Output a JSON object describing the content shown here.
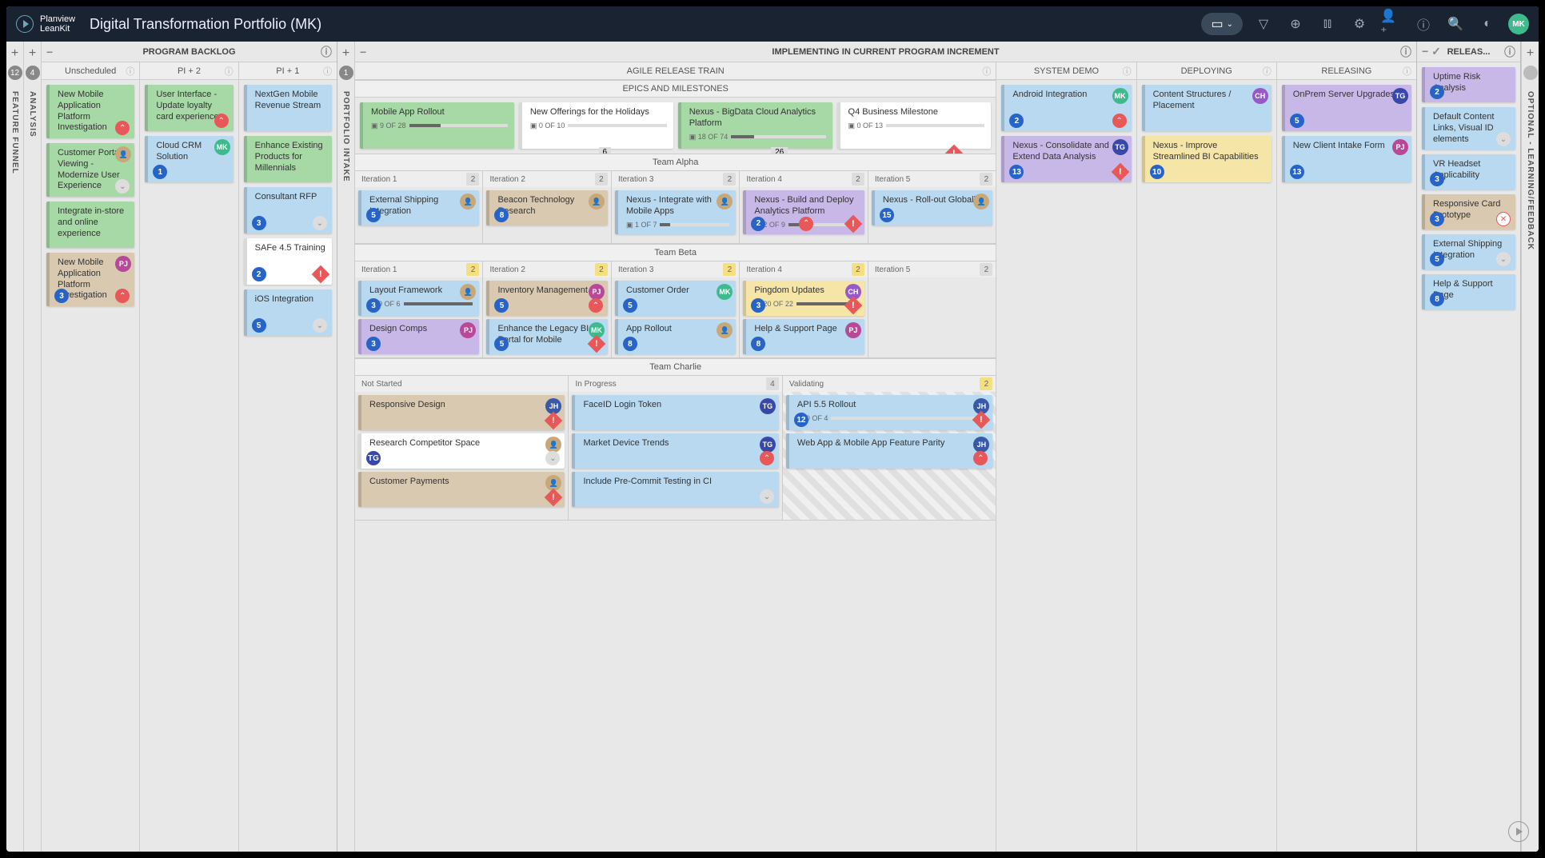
{
  "brand": {
    "name": "Planview",
    "product": "LeanKit"
  },
  "board_title": "Digital Transformation Portfolio (MK)",
  "user_avatar": "MK",
  "toolbar_icons": [
    "board-view-icon",
    "filter-icon",
    "zoom-icon",
    "analytics-icon",
    "settings-icon",
    "add-user-icon",
    "info-icon",
    "search-icon",
    "notifications-icon"
  ],
  "rails": {
    "left1": {
      "count": "12",
      "label": "FEATURE FUNNEL"
    },
    "left2": {
      "count": "4",
      "label": "ANALYSIS"
    },
    "mid": {
      "count": "1",
      "label": "PORTFOLIO INTAKE"
    },
    "right": {
      "count": "",
      "label": "OPTIONAL - LEARNING/FEEDBACK"
    }
  },
  "lanes": {
    "backlog": {
      "title": "PROGRAM BACKLOG",
      "sublanes": [
        {
          "title": "Unscheduled",
          "cards": [
            {
              "c": "green",
              "t": "New Mobile Application Platform Investigation",
              "bot_chev": "red"
            },
            {
              "c": "green",
              "t": "Customer Portal Viewing -Modernize User Experience",
              "av": "photo",
              "bot_chev": "grey"
            },
            {
              "c": "green",
              "t": "Integrate in-store and online experience"
            },
            {
              "c": "tan",
              "t": "New Mobile Application Platform Investigation",
              "av": "PJ",
              "badge": "3",
              "bot_chev": "red"
            }
          ]
        },
        {
          "title": "PI + 2",
          "cards": [
            {
              "c": "green",
              "t": "User Interface - Update loyalty card experience",
              "bot_chev": "red"
            },
            {
              "c": "blue",
              "t": "Cloud CRM Solution",
              "av": "MK",
              "badge": "1"
            }
          ]
        },
        {
          "title": "PI + 1",
          "cards": [
            {
              "c": "blue",
              "t": "NextGen Mobile Revenue Stream"
            },
            {
              "c": "green",
              "t": "Enhance Existing Products for Millennials"
            },
            {
              "c": "blue",
              "t": "Consultant RFP",
              "badge": "3",
              "bot_chev": "grey"
            },
            {
              "c": "white",
              "t": "SAFe 4.5 Training",
              "badge": "2",
              "alert": true
            },
            {
              "c": "blue",
              "t": "iOS Integration",
              "badge": "5",
              "bot_chev": "grey"
            }
          ]
        }
      ]
    },
    "implementing": {
      "title": "IMPLEMENTING IN CURRENT PROGRAM INCREMENT",
      "art": {
        "title": "AGILE RELEASE TRAIN",
        "epics": {
          "title": "EPICS AND MILESTONES",
          "cards": [
            {
              "c": "green",
              "t": "Mobile App Rollout",
              "prog": {
                "done": 9,
                "of": 28
              }
            },
            {
              "c": "white",
              "t": "New Offerings for the Holidays",
              "prog": {
                "done": 0,
                "of": 10
              }
            },
            {
              "c": "green",
              "t": "Nexus - BigData Cloud Analytics Platform",
              "prog": {
                "done": 18,
                "of": 74
              }
            },
            {
              "c": "white",
              "t": "Q4 Business Milestone",
              "prog": {
                "done": 0,
                "of": 13
              }
            }
          ],
          "markers": [
            "6",
            "26"
          ]
        },
        "teams": [
          {
            "name": "Team Alpha",
            "iterations": [
              {
                "name": "Iteration 1",
                "wip": "2",
                "cards": [
                  {
                    "c": "blue",
                    "t": "External Shipping Integration",
                    "badge": "5",
                    "av": "photo"
                  }
                ]
              },
              {
                "name": "Iteration 2",
                "wip": "2",
                "cards": [
                  {
                    "c": "tan",
                    "t": "Beacon Technology Research",
                    "badge": "8",
                    "av": "photo"
                  }
                ]
              },
              {
                "name": "Iteration 3",
                "wip": "2",
                "cards": [
                  {
                    "c": "blue",
                    "t": "Nexus - Integrate with Mobile Apps",
                    "prog": {
                      "done": 1,
                      "of": 7
                    },
                    "av": "photo"
                  }
                ]
              },
              {
                "name": "Iteration 4",
                "wip": "2",
                "cards": [
                  {
                    "c": "purple",
                    "t": "Nexus - Build and Deploy Analytics Platform",
                    "prog": {
                      "done": 2,
                      "of": 9
                    },
                    "badge": "2",
                    "alert": true,
                    "bot_chev": "red"
                  }
                ]
              },
              {
                "name": "Iteration 5",
                "wip": "2",
                "cards": [
                  {
                    "c": "blue",
                    "t": "Nexus - Roll-out Globally",
                    "badge": "15",
                    "av": "photo"
                  }
                ]
              }
            ]
          },
          {
            "name": "Team Beta",
            "iterations": [
              {
                "name": "Iteration 1",
                "wip": "2",
                "wipy": true,
                "cards": [
                  {
                    "c": "blue",
                    "t": "Layout Framework",
                    "prog": {
                      "done": 9,
                      "of": 6
                    },
                    "badge": "3",
                    "av": "photo"
                  },
                  {
                    "c": "purple",
                    "t": "Design Comps",
                    "badge": "3",
                    "av": "PJ"
                  }
                ]
              },
              {
                "name": "Iteration 2",
                "wip": "2",
                "wipy": true,
                "cards": [
                  {
                    "c": "tan",
                    "t": "Inventory Management",
                    "badge": "5",
                    "av": "PJ",
                    "bot_chev": "red"
                  },
                  {
                    "c": "blue",
                    "t": "Enhance the Legacy BI Portal for Mobile",
                    "badge": "5",
                    "av": "MK",
                    "alert": true
                  }
                ]
              },
              {
                "name": "Iteration 3",
                "wip": "2",
                "wipy": true,
                "cards": [
                  {
                    "c": "blue",
                    "t": "Customer Order",
                    "badge": "5",
                    "av": "MK"
                  },
                  {
                    "c": "blue",
                    "t": "App Rollout",
                    "badge": "8",
                    "av": "photo"
                  }
                ]
              },
              {
                "name": "Iteration 4",
                "wip": "2",
                "wipy": true,
                "cards": [
                  {
                    "c": "yellow",
                    "t": "Pingdom Updates",
                    "prog": {
                      "done": 20,
                      "of": 22
                    },
                    "badge": "3",
                    "av": "CH",
                    "alert": true
                  },
                  {
                    "c": "blue",
                    "t": "Help & Support Page",
                    "badge": "8",
                    "av": "PJ"
                  }
                ]
              },
              {
                "name": "Iteration 5",
                "wip": "2",
                "cards": []
              }
            ]
          },
          {
            "name": "Team Charlie",
            "sublanes": [
              {
                "name": "Not Started",
                "cards": [
                  {
                    "c": "tan",
                    "t": "Responsive Design",
                    "av": "JH",
                    "alert": true
                  },
                  {
                    "c": "white",
                    "t": "Research Competitor Space",
                    "av": "photo",
                    "badge_tg": "TG",
                    "bot_chev": "grey"
                  },
                  {
                    "c": "tan",
                    "t": "Customer Payments",
                    "av": "photo",
                    "alert": true
                  }
                ]
              },
              {
                "name": "In Progress",
                "wip": "4",
                "cards": [
                  {
                    "c": "blue",
                    "t": "FaceID Login Token",
                    "av": "TG"
                  },
                  {
                    "c": "blue",
                    "t": "Market Device Trends",
                    "av": "TG",
                    "bot_chev": "red"
                  },
                  {
                    "c": "blue",
                    "t": "Include Pre-Commit Testing in CI",
                    "bot_chev": "grey"
                  }
                ]
              },
              {
                "name": "Validating",
                "wip": "2",
                "wipy": true,
                "cards": [
                  {
                    "c": "blue",
                    "t": "API 5.5 Rollout",
                    "prog": {
                      "done": 0,
                      "of": 4
                    },
                    "badge": "12",
                    "av": "JH",
                    "alert": true
                  },
                  {
                    "c": "blue",
                    "t": "Web App & Mobile App Feature Parity",
                    "av": "JH",
                    "bot_chev": "red"
                  }
                ]
              }
            ]
          }
        ]
      },
      "right_lanes": [
        {
          "title": "SYSTEM DEMO",
          "cards": [
            {
              "c": "blue",
              "t": "Android Integration",
              "av": "MK",
              "badge": "2",
              "bot_chev": "red"
            },
            {
              "c": "purple",
              "t": "Nexus - Consolidate and Extend Data Analysis",
              "av": "TG",
              "badge": "13",
              "alert": true
            }
          ]
        },
        {
          "title": "DEPLOYING",
          "cards": [
            {
              "c": "blue",
              "t": "Content Structures / Placement",
              "av": "CH"
            },
            {
              "c": "yellow",
              "t": "Nexus - Improve Streamlined BI Capabilities",
              "badge": "10"
            }
          ]
        },
        {
          "title": "RELEASING",
          "cards": [
            {
              "c": "purple",
              "t": "OnPrem Server Upgrades",
              "av": "TG",
              "badge": "5"
            },
            {
              "c": "blue",
              "t": "New Client Intake Form",
              "av": "PJ",
              "badge": "13"
            }
          ]
        }
      ]
    },
    "released": {
      "title": "RELEAS...",
      "cards": [
        {
          "c": "purple",
          "t": "Uptime Risk Analysis",
          "badge": "2"
        },
        {
          "c": "blue",
          "t": "Default Content Links, Visual ID elements",
          "bot_chev": "grey"
        },
        {
          "c": "blue",
          "t": "VR Headset Applicability",
          "badge": "3"
        },
        {
          "c": "tan",
          "t": "Responsive Card Prototype",
          "badge": "3",
          "close": true
        },
        {
          "c": "blue",
          "t": "External Shipping Integration",
          "badge": "5",
          "bot_chev": "grey"
        },
        {
          "c": "blue",
          "t": "Help & Support Page",
          "badge": "8"
        }
      ]
    }
  }
}
